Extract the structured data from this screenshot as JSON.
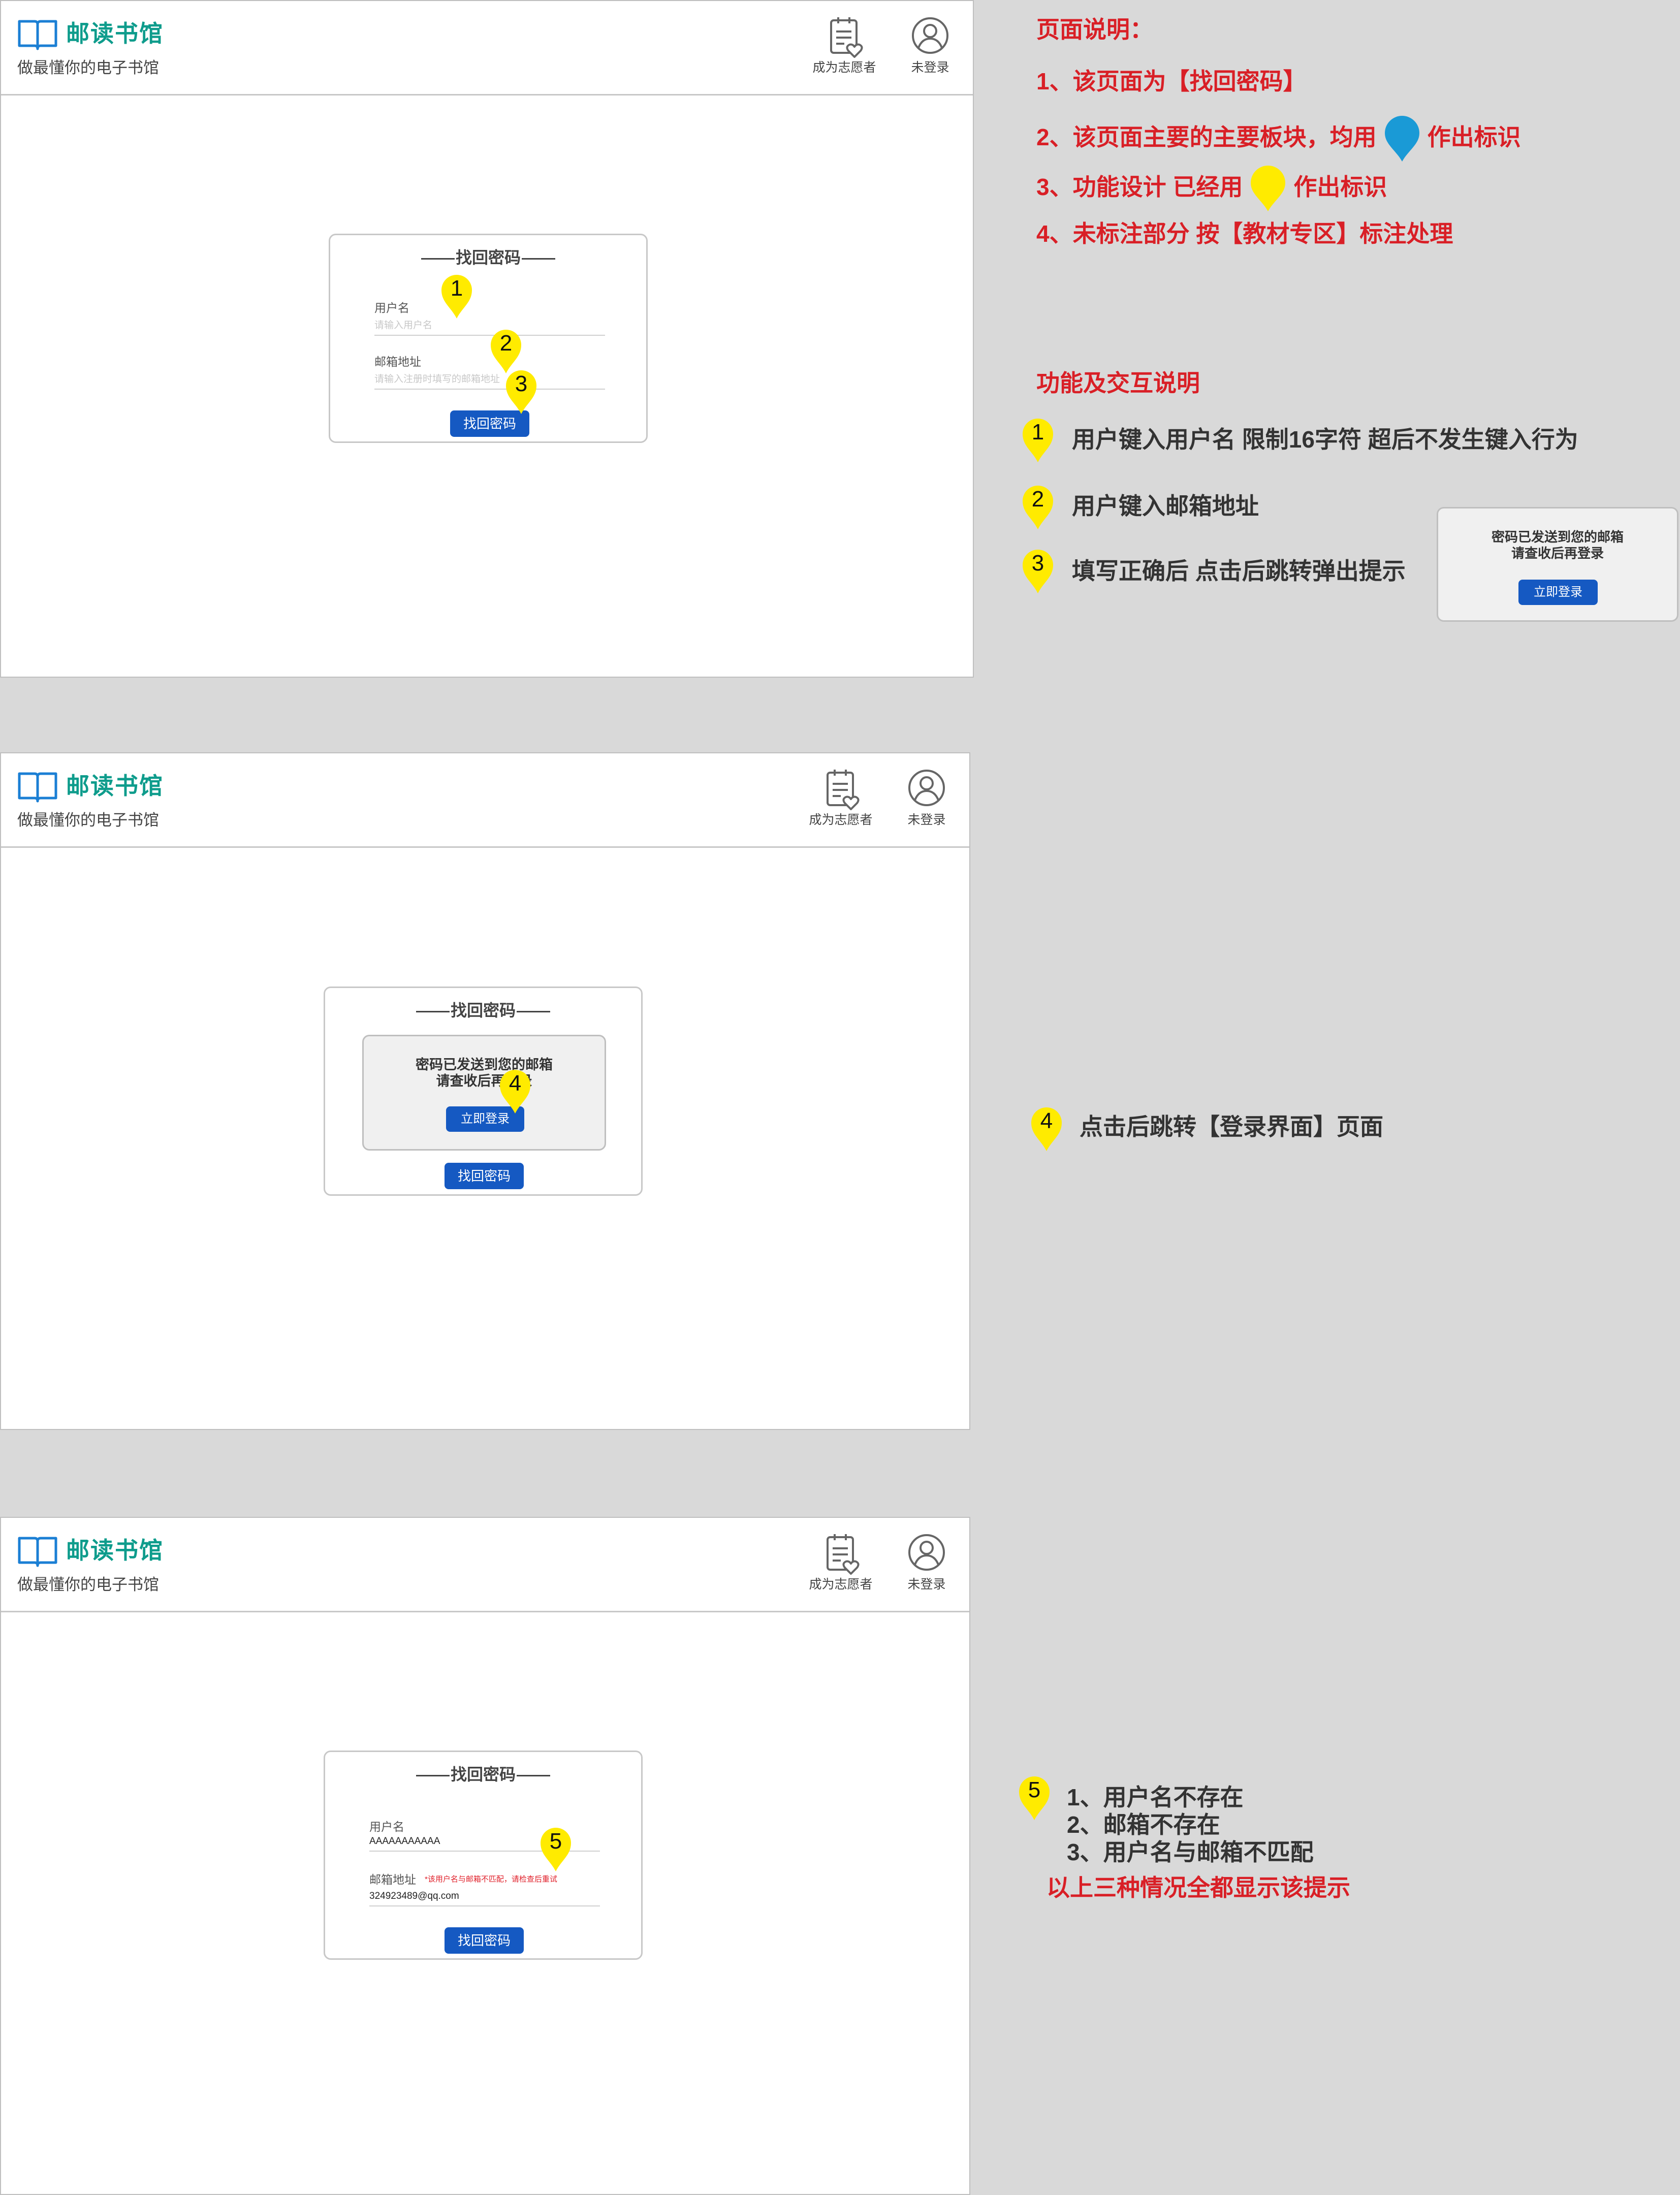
{
  "header": {
    "brand_name": "邮读书馆",
    "slogan": "做最懂你的电子书馆",
    "volunteer_label": "成为志愿者",
    "login_label": "未登录"
  },
  "form": {
    "title": "找回密码",
    "username_label": "用户名",
    "username_placeholder": "请输入用户名",
    "email_label": "邮箱地址",
    "email_placeholder": "请输入注册时填写的邮箱地址",
    "submit_label": "找回密码"
  },
  "notice": {
    "line1": "密码已发送到您的邮箱",
    "line2": "请查收后再登录",
    "login_now": "立即登录"
  },
  "error_state": {
    "username_value": "AAAAAAAAAAA",
    "email_value": "324923489@qq.com",
    "error_message": "*该用户名与邮箱不匹配，请检查后重试"
  },
  "pins": {
    "p1": "1",
    "p2": "2",
    "p3": "3",
    "p4": "4",
    "p5": "5"
  },
  "notes": {
    "page_desc_title": "页面说明：",
    "line1": "1、该页面为【找回密码】",
    "line2_a": "2、该页面主要的主要板块，均用",
    "line2_b": "作出标识",
    "line3_a": "3、功能设计 已经用",
    "line3_b": "作出标识",
    "line4": "4、未标注部分 按【教材专区】标注处理",
    "func_title": "功能及交互说明",
    "func1": "用户键入用户名 限制16字符 超后不发生键入行为",
    "func2": "用户键入邮箱地址",
    "func3": "填写正确后 点击后跳转弹出提示",
    "func4": "点击后跳转【登录界面】页面",
    "func5_1": "1、用户名不存在",
    "func5_2": "2、邮箱不存在",
    "func5_3": "3、用户名与邮箱不匹配",
    "func5_summary": "以上三种情况全都显示该提示"
  },
  "colors": {
    "brand": "#0e9c8c",
    "primary_button": "#1559c2",
    "annotation_red": "#d91f26",
    "pin_yellow": "#ffeb00",
    "pin_blue": "#1a9ad6"
  }
}
